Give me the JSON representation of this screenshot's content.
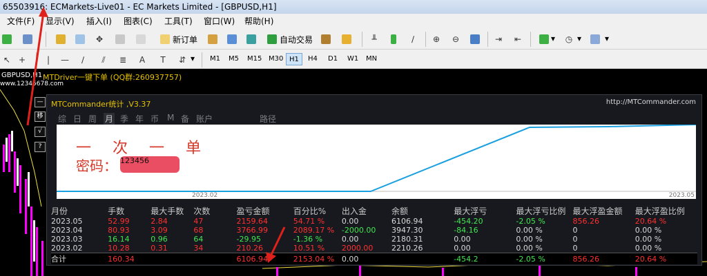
{
  "window": {
    "title": "65503916: ECMarkets-Live01 - EC Markets Limited - [GBPUSD,H1]"
  },
  "menu": [
    "文件(F)",
    "显示(V)",
    "插入(I)",
    "图表(C)",
    "工具(T)",
    "窗口(W)",
    "帮助(H)"
  ],
  "toolbar": {
    "new_order": "新订单",
    "auto_trade": "自动交易"
  },
  "timeframes": [
    "M1",
    "M5",
    "M15",
    "M30",
    "H1",
    "H4",
    "D1",
    "W1",
    "MN"
  ],
  "active_timeframe": "H1",
  "chart": {
    "symbol": "GBPUSD,H1",
    "website": "www.12345678.com",
    "driver_text": "MTDriver一键下单 (QQ群:260937757)"
  },
  "side_buttons": [
    "—",
    "移",
    "√",
    "?"
  ],
  "panel": {
    "title": "MTCommander统计 ,V3.37",
    "url": "http://MTCommander.com",
    "tabs": [
      "综",
      "日",
      "周",
      "月",
      "季",
      "年",
      "币",
      "M",
      "备",
      "账户",
      "路径"
    ],
    "active_tab": "月",
    "overlay_line1": "一 次 一 单",
    "overlay_line2": "密码：",
    "overlay_blurred": "123456",
    "axis_start": "2023.02",
    "axis_end": "2023.05",
    "columns": [
      "月份",
      "手数",
      "最大手数",
      "次数",
      "盈亏金额",
      "百分比%",
      "出入金",
      "余额",
      "最大浮亏",
      "最大浮亏比例",
      "最大浮盈金额",
      "最大浮盈比例"
    ],
    "rows": [
      {
        "cells": [
          "2023.05",
          "52.99",
          "2.84",
          "47",
          "2159.64",
          "54.71 %",
          "0.00",
          "6106.94",
          "-454.20",
          "-2.05 %",
          "856.26",
          "20.64 %"
        ],
        "colors": [
          "w",
          "r",
          "r",
          "r",
          "r",
          "r",
          "w",
          "w",
          "gr",
          "gr",
          "r",
          "r"
        ]
      },
      {
        "cells": [
          "2023.04",
          "80.93",
          "3.09",
          "68",
          "3766.99",
          "2089.17 %",
          "-2000.00",
          "3947.30",
          "-84.16",
          "0.00 %",
          "0",
          "0.00 %"
        ],
        "colors": [
          "w",
          "r",
          "r",
          "r",
          "r",
          "r",
          "gr",
          "w",
          "gr",
          "w",
          "w",
          "w"
        ]
      },
      {
        "cells": [
          "2023.03",
          "16.14",
          "0.96",
          "64",
          "-29.95",
          "-1.36 %",
          "0.00",
          "2180.31",
          "0.00",
          "0.00 %",
          "0",
          "0.00 %"
        ],
        "colors": [
          "w",
          "gr",
          "gr",
          "gr",
          "gr",
          "gr",
          "w",
          "w",
          "w",
          "w",
          "w",
          "w"
        ]
      },
      {
        "cells": [
          "2023.02",
          "10.28",
          "0.31",
          "34",
          "210.26",
          "10.51 %",
          "2000.00",
          "2210.26",
          "0.00",
          "0.00 %",
          "0",
          "0.00 %"
        ],
        "colors": [
          "w",
          "r",
          "r",
          "r",
          "r",
          "r",
          "r",
          "w",
          "w",
          "w",
          "w",
          "w"
        ]
      }
    ],
    "total": {
      "cells": [
        "合计",
        "160.34",
        "",
        "",
        "6106.94",
        "2153.04 %",
        "0.00",
        "",
        "-454.2",
        "-2.05 %",
        "856.26",
        "20.64 %"
      ],
      "colors": [
        "w",
        "r",
        "w",
        "w",
        "r",
        "r",
        "w",
        "w",
        "gr",
        "gr",
        "r",
        "r"
      ]
    },
    "balance_curve": {
      "months": [
        "2023.02",
        "2023.03",
        "2023.04",
        "2023.05"
      ],
      "values": [
        2210.26,
        2180.31,
        3947.3,
        6106.94
      ]
    }
  },
  "colors": {
    "accent_line": "#1aa0e0",
    "profit": "#ff3030",
    "loss": "#41e650"
  }
}
